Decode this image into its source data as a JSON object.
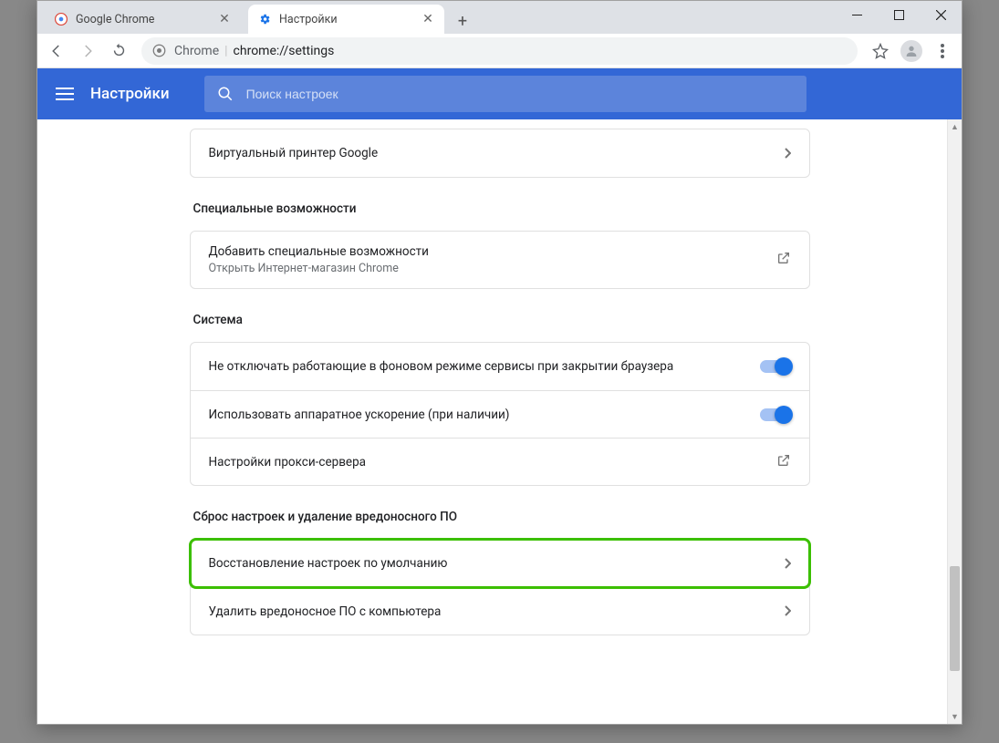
{
  "window": {
    "tabs": [
      {
        "title": "Google Chrome",
        "active": false
      },
      {
        "title": "Настройки",
        "active": true
      }
    ]
  },
  "toolbar": {
    "url_prefix": "Chrome",
    "url_path": "chrome://settings"
  },
  "header": {
    "title": "Настройки",
    "search_placeholder": "Поиск настроек"
  },
  "sections": {
    "printer_row": "Виртуальный принтер Google",
    "accessibility_title": "Специальные возможности",
    "accessibility_row_title": "Добавить специальные возможности",
    "accessibility_row_sub": "Открыть Интернет-магазин Chrome",
    "system_title": "Система",
    "system_row1": "Не отключать работающие в фоновом режиме сервисы при закрытии браузера",
    "system_row2": "Использовать аппаратное ускорение (при наличии)",
    "system_row3": "Настройки прокси-сервера",
    "reset_title": "Сброс настроек и удаление вредоносного ПО",
    "reset_row1": "Восстановление настроек по умолчанию",
    "reset_row2": "Удалить вредоносное ПО с компьютера"
  }
}
